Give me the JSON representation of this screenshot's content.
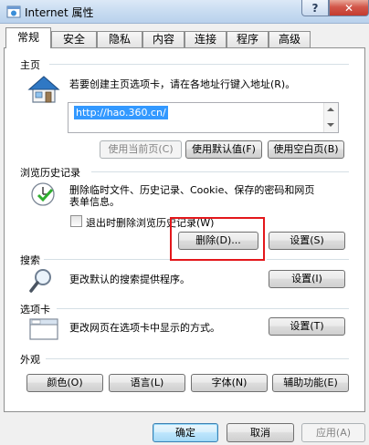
{
  "window": {
    "title": "Internet 属性",
    "help_label": "?",
    "close_label": "✕"
  },
  "tabs": [
    {
      "label": "常规",
      "active": true
    },
    {
      "label": "安全"
    },
    {
      "label": "隐私"
    },
    {
      "label": "内容"
    },
    {
      "label": "连接"
    },
    {
      "label": "程序"
    },
    {
      "label": "高级"
    }
  ],
  "homepage": {
    "title": "主页",
    "description": "若要创建主页选项卡，请在各地址行键入地址(R)。",
    "url": "http://hao.360.cn/",
    "buttons": {
      "use_current": "使用当前页(C)",
      "use_default": "使用默认值(F)",
      "use_blank": "使用空白页(B)"
    }
  },
  "history": {
    "title": "浏览历史记录",
    "description_line1": "删除临时文件、历史记录、Cookie、保存的密码和网页",
    "description_line2": "表单信息。",
    "checkbox_label": "退出时删除浏览历史记录(W)",
    "delete_label": "删除(D)...",
    "settings_label": "设置(S)"
  },
  "search": {
    "title": "搜索",
    "description": "更改默认的搜索提供程序。",
    "settings_label": "设置(I)"
  },
  "tabs_section": {
    "title": "选项卡",
    "description": "更改网页在选项卡中显示的方式。",
    "settings_label": "设置(T)"
  },
  "appearance": {
    "title": "外观",
    "colors_label": "颜色(O)",
    "languages_label": "语言(L)",
    "fonts_label": "字体(N)",
    "accessibility_label": "辅助功能(E)"
  },
  "footer": {
    "ok_label": "确定",
    "cancel_label": "取消",
    "apply_label": "应用(A)"
  }
}
